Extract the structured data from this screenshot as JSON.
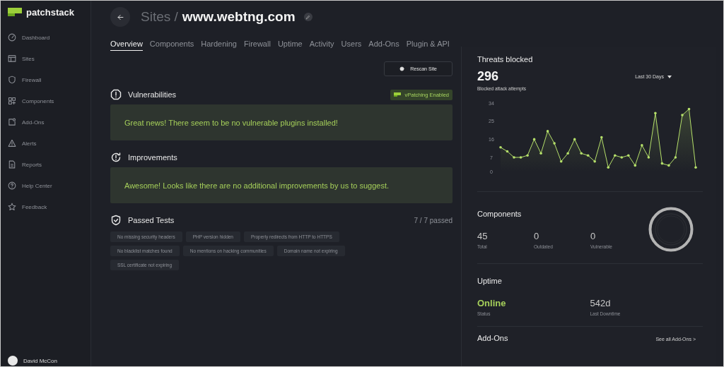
{
  "brand": {
    "name": "patchstack"
  },
  "sidebar": {
    "items": [
      {
        "label": "Dashboard"
      },
      {
        "label": "Sites"
      },
      {
        "label": "Firewall"
      },
      {
        "label": "Components"
      },
      {
        "label": "Add-Ons"
      },
      {
        "label": "Alerts"
      },
      {
        "label": "Reports"
      },
      {
        "label": "Help Center"
      },
      {
        "label": "Feedback"
      }
    ],
    "user": {
      "name": "David McCon"
    }
  },
  "header": {
    "breadcrumb": "Sites /",
    "title": "www.webtng.com"
  },
  "tabs": [
    {
      "label": "Overview",
      "selected": true
    },
    {
      "label": "Components",
      "selected": false
    },
    {
      "label": "Hardening",
      "selected": false
    },
    {
      "label": "Firewall",
      "selected": false
    },
    {
      "label": "Uptime",
      "selected": false
    },
    {
      "label": "Activity",
      "selected": false
    },
    {
      "label": "Users",
      "selected": false
    },
    {
      "label": "Add-Ons",
      "selected": false
    },
    {
      "label": "Plugin & API",
      "selected": false
    }
  ],
  "rescan_button": "Rescan Site",
  "sections": [
    {
      "kind": "vulnerabilities",
      "title": "Vulnerabilities",
      "badge": "vPatching Enabled",
      "message": "Great news! There seem to be no vulnerable plugins installed!"
    },
    {
      "kind": "improvements",
      "title": "Improvements",
      "message": "Awesome! Looks like there are no additional improvements by us to suggest."
    }
  ],
  "passed_tests": {
    "title": "Passed Tests",
    "summary": "7 / 7 passed",
    "tests": [
      "No missing security headers",
      "PHP version hidden",
      "Properly redirects from HTTP to HTTPS",
      "No blacklist matches found",
      "No mentions on hacking communities",
      "Domain name not expiring",
      "SSL certificate not expiring"
    ]
  },
  "threats": {
    "title": "Threats blocked",
    "total": "296",
    "subtitle": "Blocked attack attempts",
    "range": "Last 30 Days",
    "chart_data": {
      "type": "area",
      "ylim": [
        0,
        34
      ],
      "yticks": [
        0,
        7,
        16,
        25,
        34
      ],
      "series": [
        {
          "color": "#b5e06a",
          "values": [
            12,
            10,
            7,
            7,
            8,
            16,
            9,
            20,
            14,
            5,
            9,
            16,
            9,
            8,
            5,
            17,
            2,
            8,
            7,
            8,
            3,
            13,
            7,
            29,
            4,
            3,
            7,
            28,
            31,
            2
          ]
        }
      ]
    }
  },
  "components": {
    "title": "Components",
    "stats": [
      {
        "value": "45",
        "label": "Total"
      },
      {
        "value": "0",
        "label": "Outdated"
      },
      {
        "value": "0",
        "label": "Vulnerable"
      }
    ]
  },
  "uptime": {
    "title": "Uptime",
    "stats": [
      {
        "kind": "status",
        "value": "Online",
        "label": "Status"
      },
      {
        "kind": "plain",
        "value": "542d",
        "label": "Last Downtime"
      }
    ]
  },
  "addons": {
    "title": "Add-Ons",
    "link": "See all Add-Ons >"
  }
}
